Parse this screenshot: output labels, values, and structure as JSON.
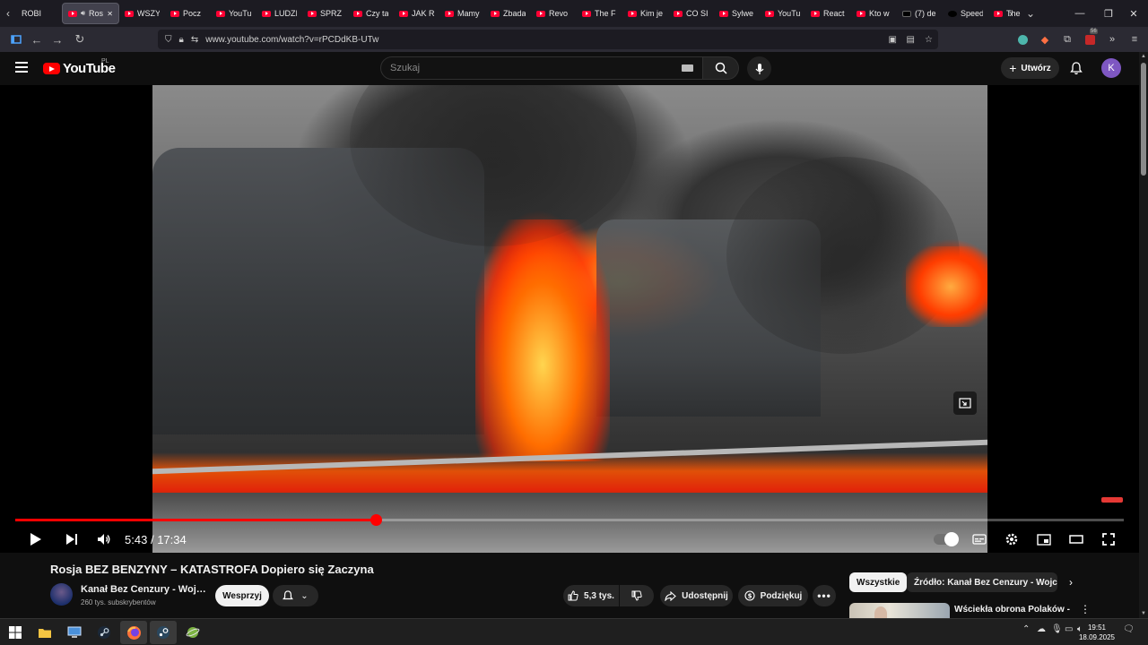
{
  "browser": {
    "tabs": [
      {
        "label": "ROBI",
        "favicon": "generic"
      },
      {
        "label": "Ros",
        "favicon": "youtube",
        "active": true,
        "audio": true
      },
      {
        "label": "WSZY",
        "favicon": "youtube"
      },
      {
        "label": "Pocz",
        "favicon": "youtube"
      },
      {
        "label": "YouTu",
        "favicon": "youtube"
      },
      {
        "label": "LUDZI",
        "favicon": "youtube"
      },
      {
        "label": "SPRZ",
        "favicon": "youtube"
      },
      {
        "label": "Czy ta",
        "favicon": "youtube"
      },
      {
        "label": "JAK R",
        "favicon": "youtube"
      },
      {
        "label": "Mamy",
        "favicon": "youtube"
      },
      {
        "label": "Zbada",
        "favicon": "youtube"
      },
      {
        "label": "Revo",
        "favicon": "youtube"
      },
      {
        "label": "The F",
        "favicon": "youtube"
      },
      {
        "label": "Kim je",
        "favicon": "youtube"
      },
      {
        "label": "CO SI",
        "favicon": "youtube"
      },
      {
        "label": "Sylwe",
        "favicon": "youtube"
      },
      {
        "label": "YouTu",
        "favicon": "youtube"
      },
      {
        "label": "React",
        "favicon": "youtube"
      },
      {
        "label": "Kto w",
        "favicon": "youtube"
      },
      {
        "label": "(7) de",
        "favicon": "x"
      },
      {
        "label": "Speed",
        "favicon": "tiktok"
      },
      {
        "label": "The",
        "favicon": "youtube"
      }
    ],
    "url": "www.youtube.com/watch?v=rPCDdKB-UTw",
    "extension_badge": "56"
  },
  "youtube": {
    "logo_text": "YouTube",
    "region": "PL",
    "search_placeholder": "Szukaj",
    "create_label": "Utwórz",
    "avatar_letter": "K",
    "colors": {
      "accent": "#ff0000",
      "background": "#0f0f0f",
      "avatar": "#7e57c2"
    }
  },
  "player": {
    "current_time": "5:43",
    "duration": "17:34",
    "time_separator": "/",
    "progress_fraction": 0.325,
    "hd_label": "HD"
  },
  "video": {
    "title": "Rosja BEZ BENZYNY – KATASTROFA Dopiero się Zaczyna",
    "channel_name": "Kanał Bez Cenzury - Wojciech Olszański",
    "subscribers": "260 tys. subskrybentów",
    "support_label": "Wesprzyj",
    "likes": "5,3 tys.",
    "share_label": "Udostępnij",
    "thanks_label": "Podziękuj"
  },
  "sidebar": {
    "chips": [
      {
        "label": "Wszystkie",
        "selected": true
      },
      {
        "label": "Źródło: Kanał Bez Cenzury - Wojciech Olszański",
        "selected": false
      }
    ],
    "recommendation": {
      "title": "Wściekła obrona Polaków - Westerplatte. Historia Bez Cenzury"
    }
  },
  "taskbar": {
    "time": "19:51",
    "date": "18.09.2025"
  }
}
